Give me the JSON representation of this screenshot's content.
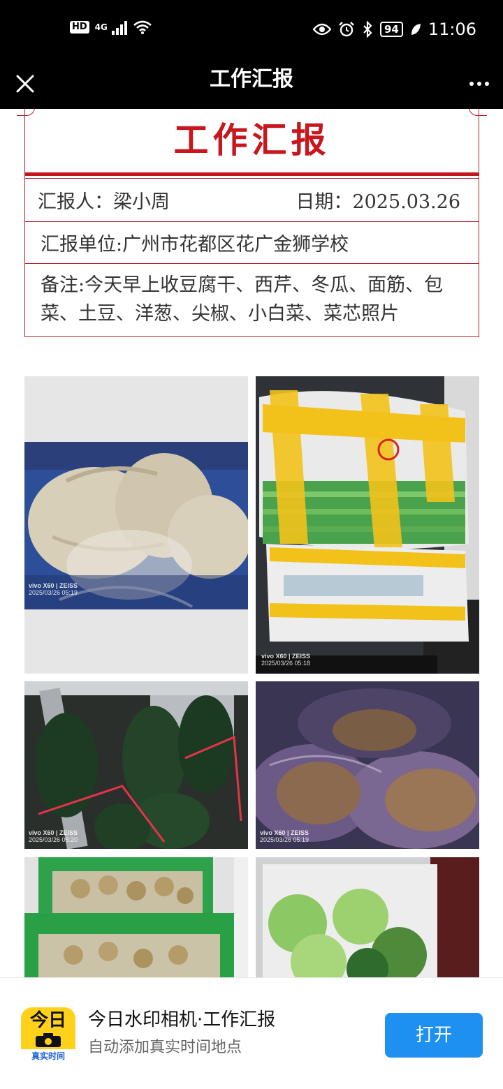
{
  "status_bar": {
    "hd": "HD",
    "network": "4G",
    "battery": "94",
    "time": "11:06"
  },
  "title_bar": {
    "title": "工作汇报"
  },
  "report": {
    "heading": "工作汇报",
    "reporter": "汇报人：梁小周",
    "date": "日期：2025.03.26",
    "unit": "汇报单位:广州市花都区花广金狮学校",
    "note": "备注:今天早上收豆腐干、西芹、冬瓜、面筋、包菜、土豆、洋葱、尖椒、小白菜、菜芯照片"
  },
  "photos": [
    {
      "brand": "vivo X60 | ZEISS",
      "timestamp": "2025/03/26 05:19"
    },
    {
      "brand": "vivo X60 | ZEISS",
      "timestamp": "2025/03/26 05:18"
    },
    {
      "brand": "vivo X60 | ZEISS",
      "timestamp": "2025/03/26 05:20"
    },
    {
      "brand": "vivo X60 | ZEISS",
      "timestamp": "2025/03/26 05:19"
    },
    {
      "brand": "",
      "timestamp": ""
    },
    {
      "brand": "",
      "timestamp": ""
    }
  ],
  "banner": {
    "icon_top": "今日",
    "icon_bottom": "真实时间",
    "title": "今日水印相机·工作汇报",
    "subtitle": "自动添加真实时间地点",
    "open_label": "打开"
  },
  "colors": {
    "accent_red": "#c8161d",
    "button_blue": "#1e90f0",
    "icon_yellow": "#ffd11a"
  }
}
